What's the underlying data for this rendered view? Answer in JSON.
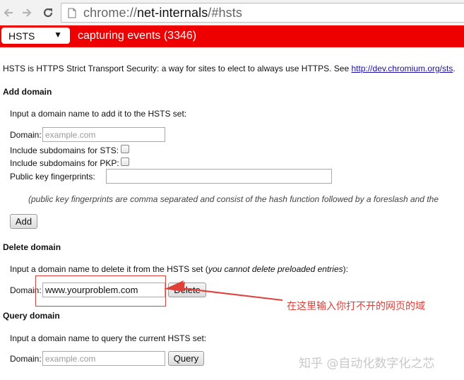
{
  "browser": {
    "url_scheme": "chrome://",
    "url_host": "net-internals",
    "url_path": "/#hsts",
    "icons": [
      "back-arrow-icon",
      "forward-arrow-icon",
      "reload-icon",
      "page-icon"
    ]
  },
  "capture_bar": {
    "tab_selected": "HSTS",
    "status": "capturing events (3346)",
    "color": "#ee0000"
  },
  "intro": {
    "text": "HSTS is HTTPS Strict Transport Security: a way for sites to elect to always use HTTPS. See ",
    "link": "http://dev.chromium.org/sts",
    "end": "."
  },
  "add_domain": {
    "title": "Add domain",
    "description": "Input a domain name to add it to the HSTS set:",
    "domain_label": "Domain:",
    "domain_placeholder": "example.com",
    "sts_label": "Include subdomains for STS:",
    "pkp_label": "Include subdomains for PKP:",
    "fingerprints_label": "Public key fingerprints:",
    "note": "(public key fingerprints are comma separated and consist of the hash function followed by a foreslash and the",
    "button": "Add"
  },
  "delete_domain": {
    "title": "Delete domain",
    "description": "Input a domain name to delete it from the HSTS set (",
    "description_em": "you cannot delete preloaded entries",
    "description_end": "):",
    "domain_label": "Domain:",
    "domain_value": "www.yourproblem.com",
    "button": "Delete"
  },
  "query_domain": {
    "title": "Query domain",
    "description": "Input a domain name to query the current HSTS set:",
    "domain_label": "Domain:",
    "domain_placeholder": "example.com",
    "button": "Query"
  },
  "annotation": {
    "text": "在这里输入你打不开的网页的域",
    "color": "#e0403a"
  },
  "watermark": "知乎 @自动化数字化之芯"
}
